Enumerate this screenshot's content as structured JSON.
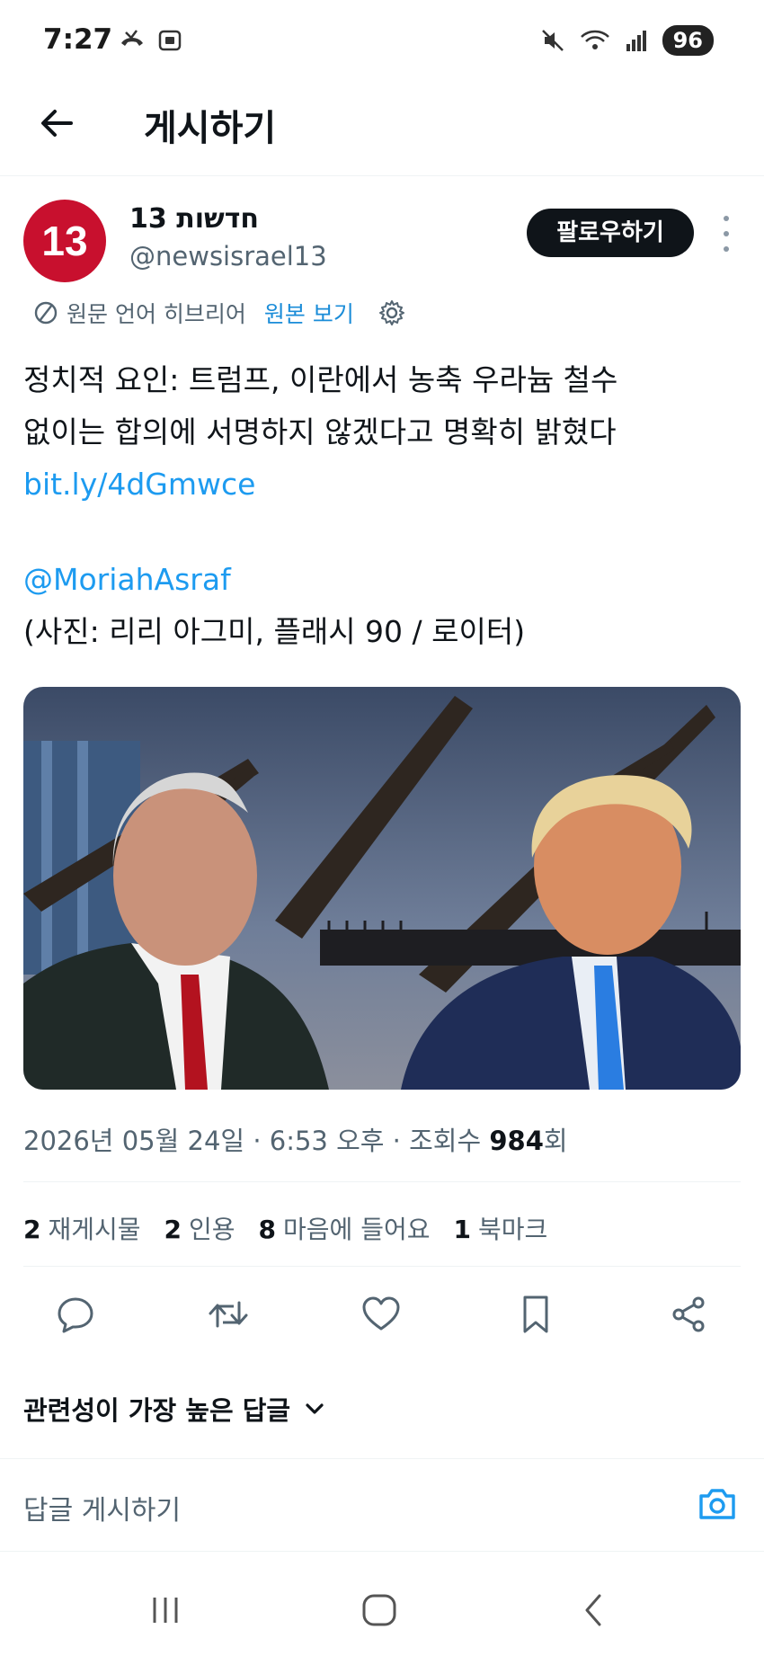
{
  "status_bar": {
    "time": "7:27",
    "battery": "96"
  },
  "header": {
    "title": "게시하기"
  },
  "author": {
    "name": "חדשות 13",
    "handle": "@newsisrael13",
    "avatar_text": "13"
  },
  "follow_label": "팔로우하기",
  "translation": {
    "label": "원문 언어 히브리어",
    "show_original": "원본 보기"
  },
  "tweet": {
    "line1": "정치적 요인: 트럼프, 이란에서 농축 우라늄 철수",
    "line2": "없이는 합의에 서명하지 않겠다고 명확히 밝혔다",
    "link": "bit.ly/4dGmwce",
    "mention": "@MoriahAsraf",
    "credit": "(사진: 리리 아그미, 플래시 90 / 로이터)"
  },
  "meta": {
    "date": "2026년 05월 24일",
    "sep": "·",
    "time": "6:53 오후",
    "views_label": "조회수",
    "views": "984",
    "views_unit": "회"
  },
  "stats": [
    {
      "num": "2",
      "label": "재게시물"
    },
    {
      "num": "2",
      "label": "인용"
    },
    {
      "num": "8",
      "label": "마음에 들어요"
    },
    {
      "num": "1",
      "label": "북마크"
    }
  ],
  "sort_label": "관련성이 가장 높은 답글",
  "reply_placeholder": "답글 게시하기",
  "colors": {
    "accent": "#1d9bf0",
    "text": "#0f1419",
    "muted": "#536471",
    "brand_red": "#c8102e"
  }
}
